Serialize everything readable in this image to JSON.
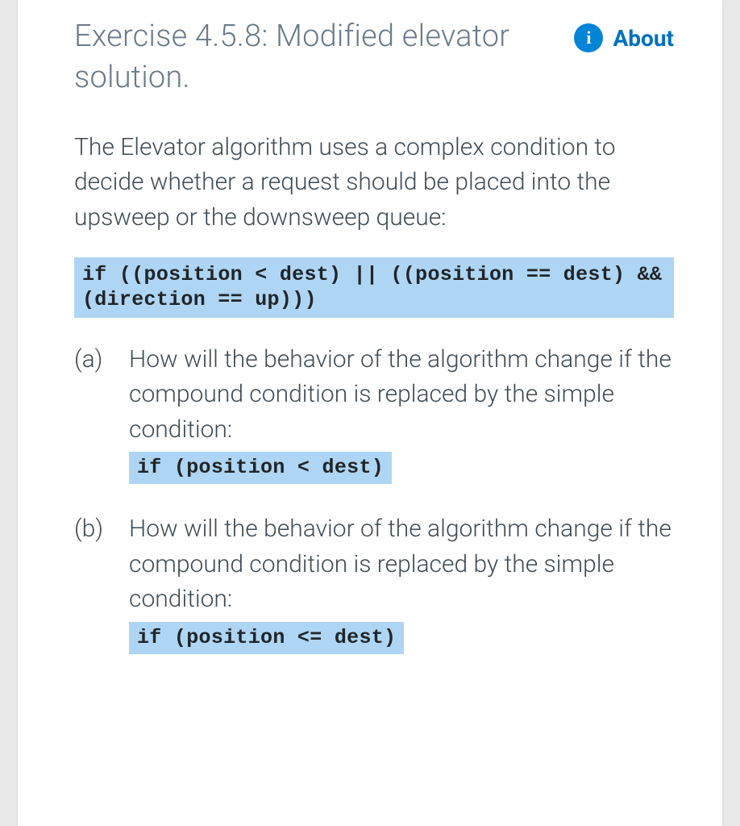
{
  "title": "Exercise 4.5.8: Modified elevator solution.",
  "about_label": "About",
  "intro": "The Elevator algorithm uses a complex condition to decide whether a request should be placed into the upsweep or the downsweep queue:",
  "code_main": "if ((position < dest) || ((position == dest) && (direction == up)))",
  "questions": [
    {
      "label": "(a)",
      "text": "How will the behavior of the algorithm change if the compound condition is replaced by the simple condition:",
      "code": "if (position < dest)"
    },
    {
      "label": "(b)",
      "text": "How will the behavior of the algorithm change if the compound condition is replaced by the simple condition:",
      "code": "if (position <= dest)"
    }
  ]
}
